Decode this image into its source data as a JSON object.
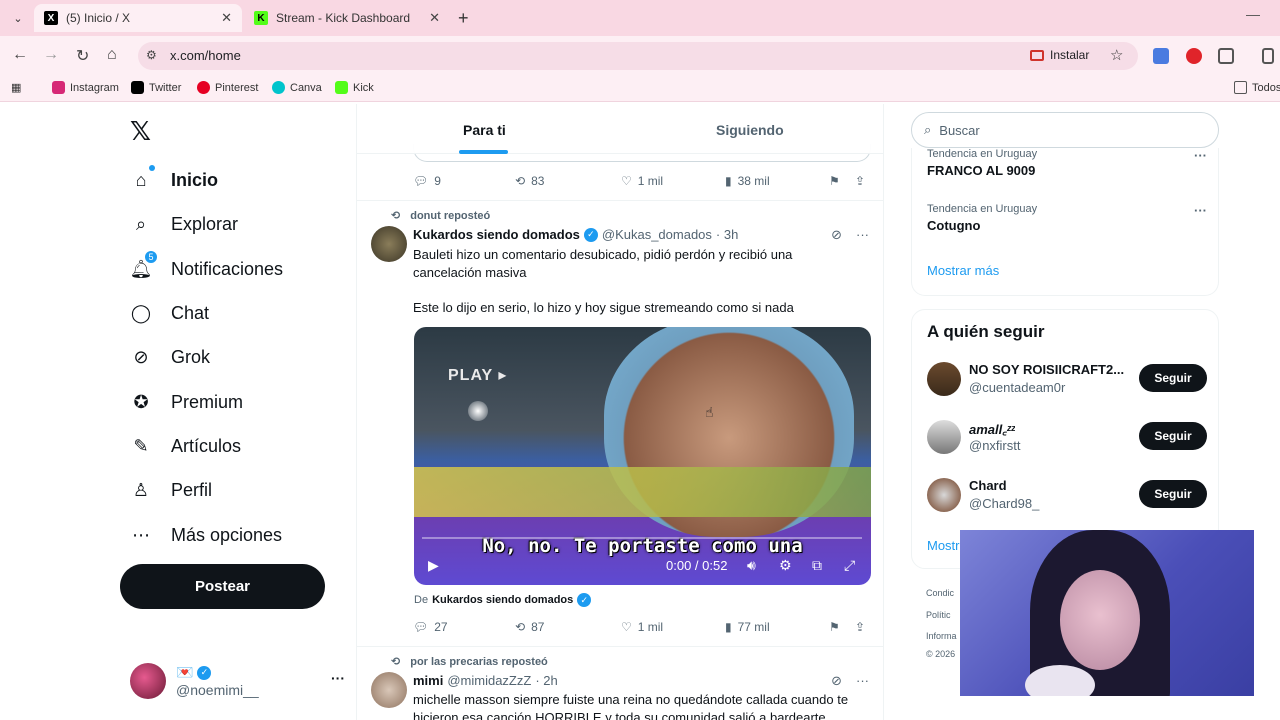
{
  "browser": {
    "tabs": [
      {
        "title": "(5) Inicio / X",
        "favicon": "X",
        "active": true
      },
      {
        "title": "Stream - Kick Dashboard",
        "favicon": "K",
        "active": false
      }
    ],
    "url": "x.com/home",
    "install_label": "Instalar",
    "bookmarks": [
      {
        "label": "Instagram",
        "color": "#d62976"
      },
      {
        "label": "Twitter",
        "color": "#000000"
      },
      {
        "label": "Pinterest",
        "color": "#e60023"
      },
      {
        "label": "Canva",
        "color": "#00c4cc"
      },
      {
        "label": "Kick",
        "color": "#53fc18"
      }
    ],
    "bookmarks_folder": "Todos"
  },
  "nav": {
    "items": [
      {
        "label": "Inicio",
        "icon": "home-icon",
        "active": true
      },
      {
        "label": "Explorar",
        "icon": "search-icon"
      },
      {
        "label": "Notificaciones",
        "icon": "bell-icon",
        "badge": "5"
      },
      {
        "label": "Chat",
        "icon": "chat-icon"
      },
      {
        "label": "Grok",
        "icon": "grok-icon"
      },
      {
        "label": "Premium",
        "icon": "premium-icon"
      },
      {
        "label": "Artículos",
        "icon": "articles-icon"
      },
      {
        "label": "Perfil",
        "icon": "person-icon"
      },
      {
        "label": "Más opciones",
        "icon": "more-circle-icon"
      }
    ],
    "post_label": "Postear",
    "account": {
      "name": "💌",
      "handle": "@noemimi__"
    }
  },
  "feed": {
    "tabs": [
      "Para ti",
      "Siguiendo"
    ],
    "top_actions": {
      "replies": "9",
      "reposts": "83",
      "likes": "1 mil",
      "views": "38 mil"
    },
    "tweet1": {
      "repost_by": "donut reposteó",
      "name": "Kukardos siendo domados",
      "handle": "@Kukas_domados",
      "time": "· 3h",
      "text1": "Bauleti hizo un comentario desubicado, pidió perdón y recibió una cancelación masiva",
      "text2": "Este lo dijo en serio, lo hizo y hoy sigue stremeando como si nada",
      "video": {
        "overlay": "PLAY ▸",
        "subtitle": "No, no. Te portaste como una",
        "time": "0:00 / 0:52"
      },
      "from_prefix": "De",
      "from_name": "Kukardos siendo domados",
      "actions": {
        "replies": "27",
        "reposts": "87",
        "likes": "1 mil",
        "views": "77 mil"
      }
    },
    "tweet2": {
      "repost_by": "por las precarias reposteó",
      "name": "mimi",
      "handle": "@mimidazZzZ",
      "time": "· 2h",
      "text": "michelle masson siempre fuiste una reina no quedándote callada cuando te hicieron esa canción HORRIBLE y toda su comunidad salió a bardearte"
    }
  },
  "right": {
    "search_placeholder": "Buscar",
    "trends": [
      {
        "context": "Tendencia en Uruguay",
        "name": "FRANCO AL 9009"
      },
      {
        "context": "Tendencia en Uruguay",
        "name": "Cotugno"
      }
    ],
    "show_more": "Mostrar más",
    "follow_title": "A quién seguir",
    "follow": [
      {
        "name": "NO SOY ROISIICRAFT2...",
        "handle": "@cuentadeam0r",
        "button": "Seguir"
      },
      {
        "name": "amall꜀ᶻᶻ",
        "handle": "@nxfirstt",
        "button": "Seguir"
      },
      {
        "name": "Chard",
        "handle": "@Chard98_",
        "button": "Seguir"
      }
    ],
    "follow_more": "Mostr",
    "footer": [
      "Condic",
      "Polític",
      "Informa",
      "© 2026"
    ]
  }
}
